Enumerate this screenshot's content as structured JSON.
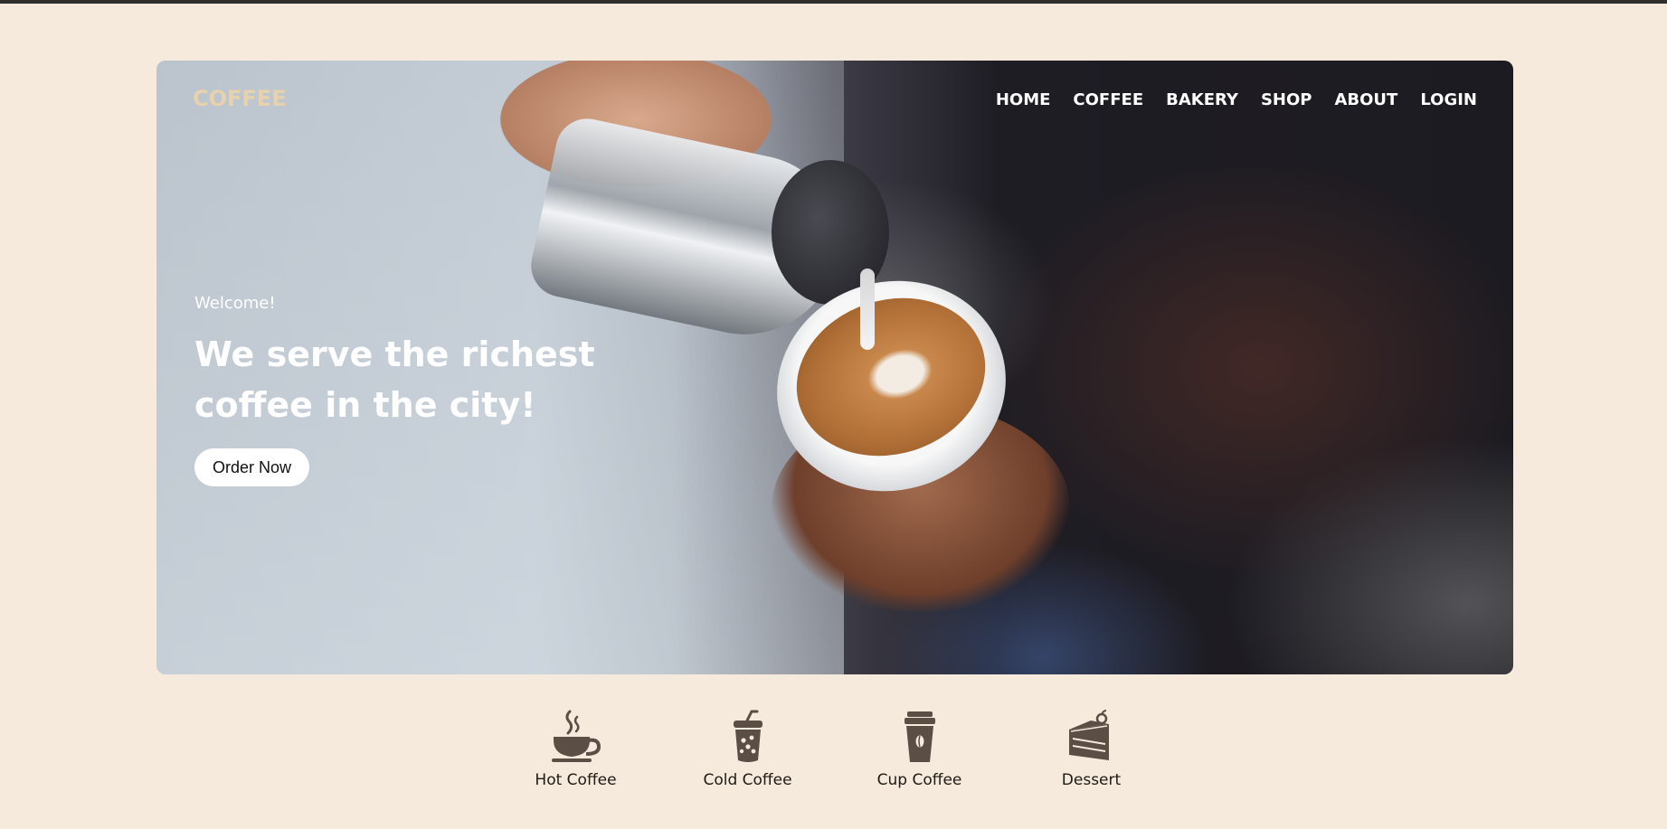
{
  "brand": {
    "logo": "COFFEE",
    "logo_color": "#e8d2ad"
  },
  "nav": {
    "items": [
      {
        "label": "HOME"
      },
      {
        "label": "COFFEE"
      },
      {
        "label": "BAKERY"
      },
      {
        "label": "SHOP"
      },
      {
        "label": "ABOUT"
      },
      {
        "label": "LOGIN"
      }
    ]
  },
  "hero": {
    "welcome": "Welcome!",
    "headline": "We serve the richest coffee in the city!",
    "cta_label": "Order Now"
  },
  "categories": [
    {
      "label": "Hot Coffee",
      "icon": "hot-coffee-icon"
    },
    {
      "label": "Cold Coffee",
      "icon": "cold-coffee-icon"
    },
    {
      "label": "Cup Coffee",
      "icon": "cup-coffee-icon"
    },
    {
      "label": "Dessert",
      "icon": "dessert-icon"
    }
  ],
  "colors": {
    "page_background": "#f5eadb",
    "icon_color": "#5a4e45",
    "button_background": "#ffffff"
  }
}
